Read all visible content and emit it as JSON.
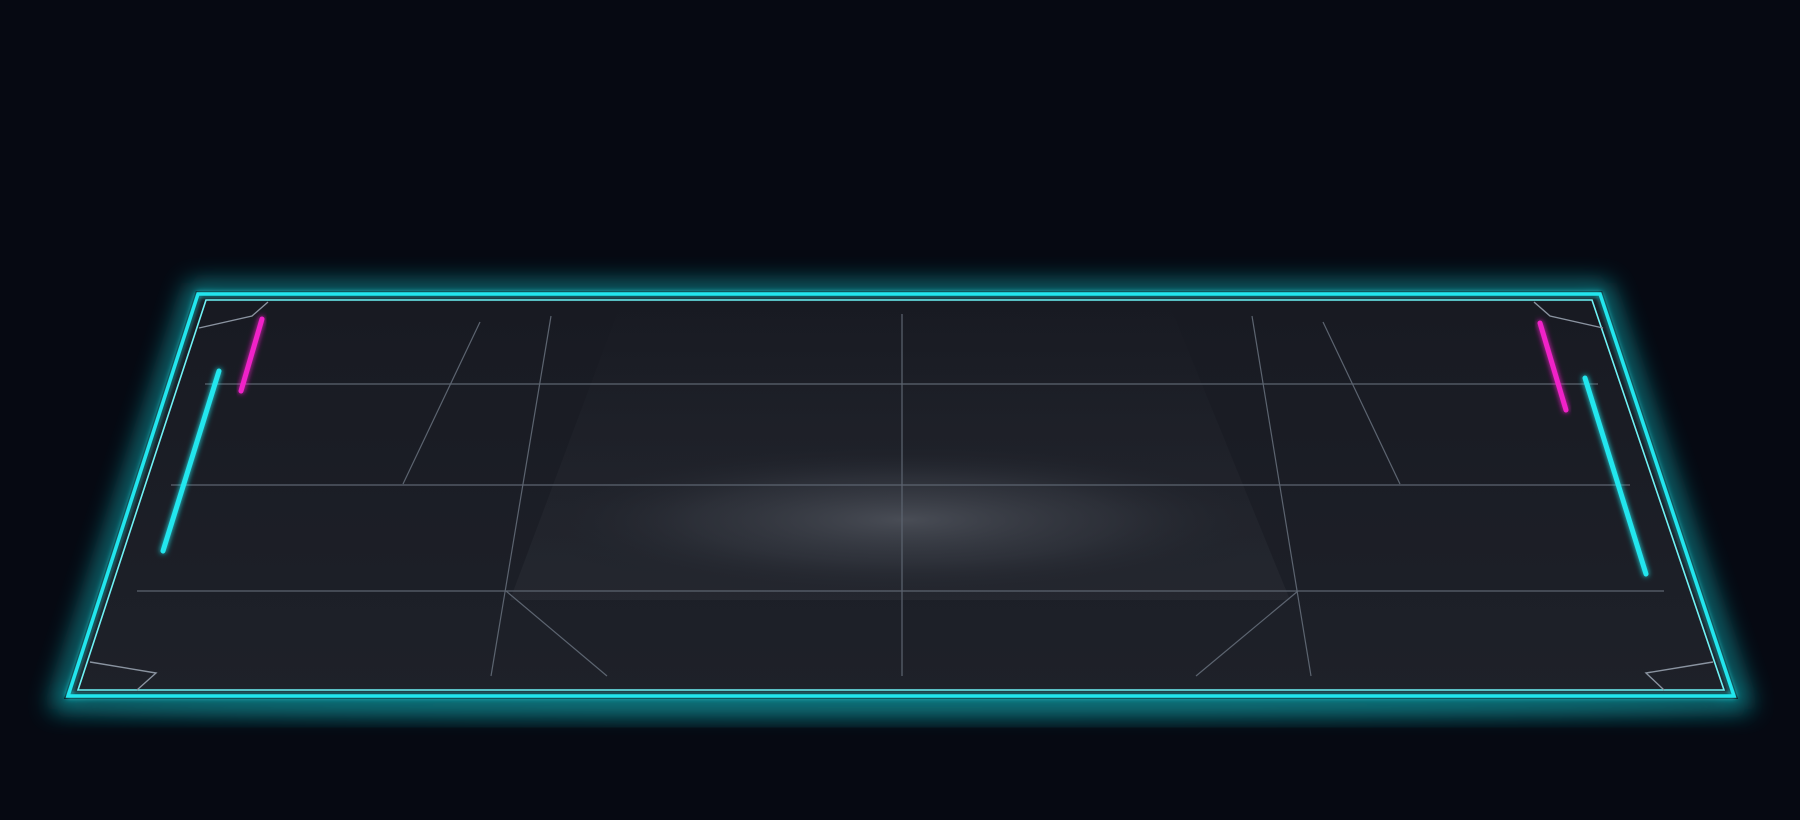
{
  "scene": {
    "type": "neon arena floor, perspective view, empty",
    "colors": {
      "background": "#060912",
      "floor": "#16181f",
      "floor_inner": "#1b1e26",
      "rim_glow": "#19e3ea",
      "neon_cyan": "#22e6ee",
      "neon_magenta": "#f020c8",
      "grid_line": "#5c6470",
      "center_light": "#4a4e57"
    },
    "icons": {
      "corner_brackets": "corner-bracket-shape",
      "neon_bars": "neon-bar-shape"
    },
    "neon_bar_colors_in_order": [
      "cyan",
      "magenta",
      "cyan",
      "magenta",
      "cyan",
      "magenta",
      "cyan",
      "cyan",
      "magenta",
      "cyan"
    ]
  }
}
